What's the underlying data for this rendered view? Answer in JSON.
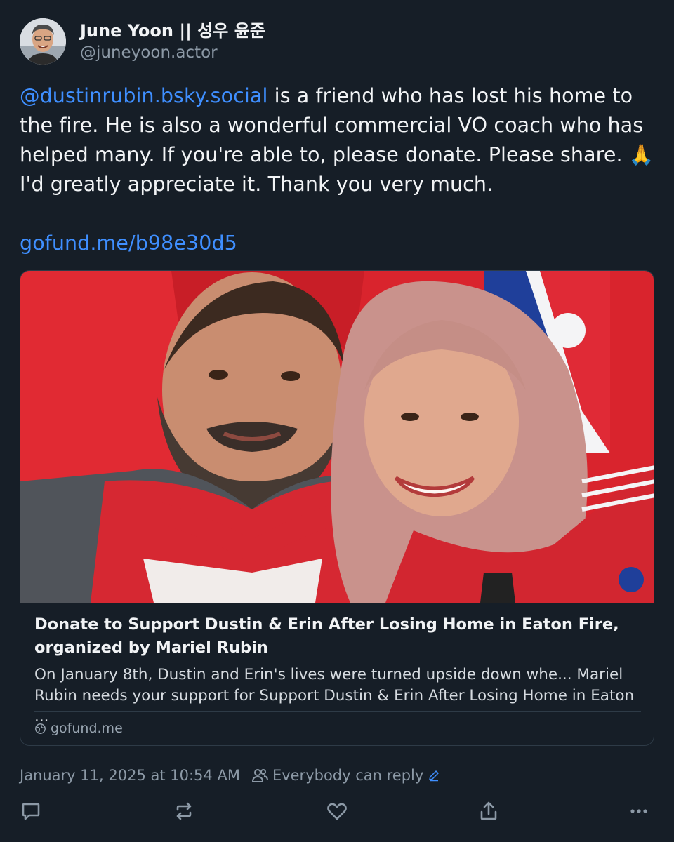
{
  "author": {
    "display_name": "June Yoon || 성우 윤준",
    "handle": "@juneyoon.actor",
    "avatar_icon": "avatar-photo"
  },
  "post": {
    "mention": "@dustinrubin.bsky.social",
    "text": " is a friend who has lost his home to the fire. He is also a wonderful commercial VO coach who has helped many. If you're able to, please donate. Please share. 🙏 I'd greatly appreciate it. Thank you very much.",
    "link": "gofund.me/b98e30d5"
  },
  "link_card": {
    "title": "Donate to Support Dustin & Erin After Losing Home in Eaton Fire, organized by Mariel Rubin",
    "description": "On January 8th, Dustin and Erin's lives were turned upside down whe... Mariel Rubin needs your support for Support Dustin & Erin After Losing Home in Eaton ...",
    "domain": "gofund.me",
    "domain_icon": "globe-icon",
    "image_icon": "selfie-photo"
  },
  "meta": {
    "timestamp": "January 11, 2025 at 10:54 AM",
    "reply_setting": "Everybody can reply",
    "reply_icon": "people-icon",
    "edit_icon": "pencil-icon"
  },
  "actions": {
    "reply_icon": "speech-bubble-icon",
    "repost_icon": "repost-icon",
    "like_icon": "heart-icon",
    "share_icon": "share-icon",
    "more_icon": "ellipsis-icon"
  },
  "colors": {
    "background": "#161e27",
    "text": "#f1f3f5",
    "muted": "#8c99a6",
    "link": "#3f8fff",
    "border": "#2e3b47"
  }
}
